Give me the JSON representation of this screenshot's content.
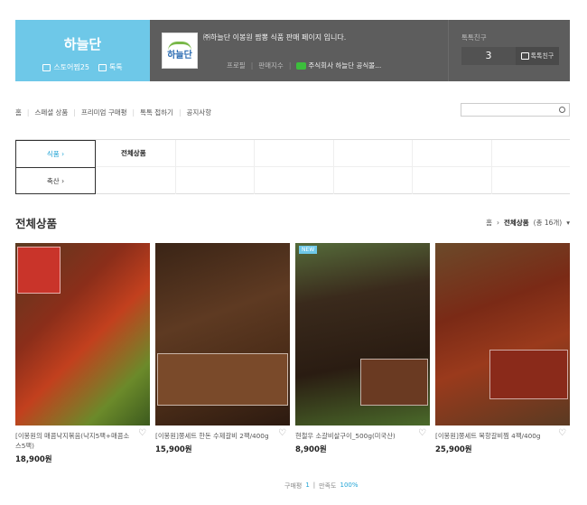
{
  "store": {
    "name": "하늘단",
    "stats": {
      "store_label": "스토어찜25",
      "talk_label": "톡톡"
    },
    "logo_text": "하늘단",
    "description": "㈜하늘단 이봉원 짬뽕 식품 판매 페이지 입니다.",
    "meta": {
      "profile": "프로필",
      "index": "판매지수",
      "shop": "주식회사 하늘단 공식몰..."
    },
    "friend": {
      "label": "톡톡친구",
      "count": "3",
      "button": "톡톡친구"
    }
  },
  "nav": {
    "items": [
      "홈",
      "스페셜 상품",
      "프리미엄 구매평",
      "톡톡 접하기",
      "공지사항"
    ]
  },
  "categories": {
    "left": [
      "식품 ›",
      "축산 ›"
    ],
    "cells": [
      "전체상품",
      "",
      "",
      "",
      "",
      "",
      "",
      "",
      "",
      "",
      "",
      ""
    ]
  },
  "section": {
    "title": "전체상품",
    "breadcrumb_home": "홈",
    "breadcrumb_current": "전체상품",
    "breadcrumb_count": "(총 16개)"
  },
  "products": [
    {
      "name": "[이봉원의 매콤낙지볶음(낙지5팩+매콤소스5팩)",
      "price": "18,900원",
      "badge": ""
    },
    {
      "name": "[이봉원]쫑세트 한돈 수제갈비 2팩/400g",
      "price": "15,900원",
      "badge": ""
    },
    {
      "name": "현철우 소갈비살구이_500g(미국산)",
      "price": "8,900원",
      "badge": "NEW"
    },
    {
      "name": "[이봉원]쫑세트 목항갈비찜 4팩/400g",
      "price": "25,900원",
      "badge": ""
    }
  ],
  "footer": {
    "reviews_label": "구매평",
    "reviews_count": "1",
    "satisfaction_label": "만족도",
    "satisfaction_value": "100%"
  }
}
